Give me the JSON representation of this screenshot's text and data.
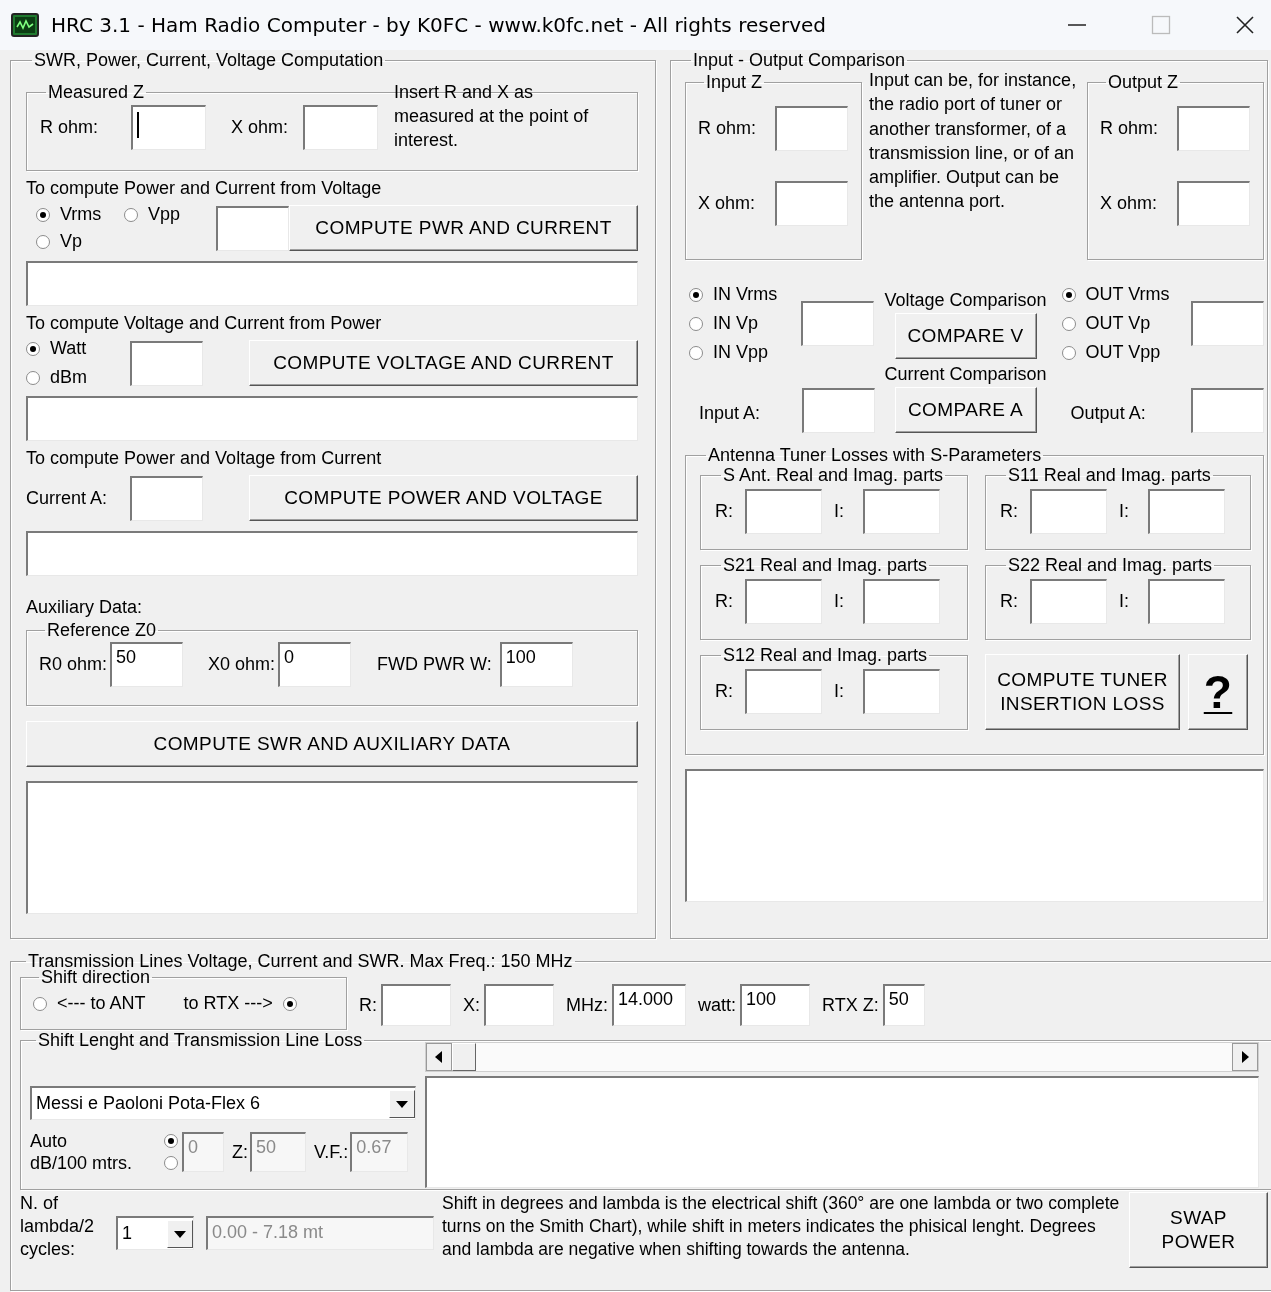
{
  "window": {
    "title": "HRC 3.1 - Ham Radio Computer - by K0FC - www.k0fc.net - All rights reserved"
  },
  "swr_panel": {
    "title": "SWR, Power, Current, Voltage Computation",
    "measured_z": {
      "title": "Measured Z",
      "fields": [
        {
          "label": "R ohm:",
          "focused": true
        },
        {
          "label": "X ohm:",
          "focused": false
        }
      ],
      "note": "Insert R and X as measured at the point of interest."
    },
    "from_voltage": {
      "heading": "To compute Power and Current from Voltage",
      "options": [
        {
          "label": "Vrms",
          "selected": true
        },
        {
          "label": "Vpp",
          "selected": false
        },
        {
          "label": "Vp",
          "selected": false
        }
      ],
      "button": "COMPUTE PWR AND CURRENT"
    },
    "from_power": {
      "heading": "To compute Voltage and Current from Power",
      "options": [
        {
          "label": "Watt",
          "selected": true
        },
        {
          "label": "dBm",
          "selected": false
        }
      ],
      "button": "COMPUTE VOLTAGE AND CURRENT"
    },
    "from_current": {
      "heading": "To compute Power and Voltage from Current",
      "field_label": "Current A:",
      "button": "COMPUTE POWER AND VOLTAGE"
    },
    "auxiliary_label": "Auxiliary Data:",
    "reference_z0": {
      "title": "Reference Z0",
      "fields": [
        {
          "label": "R0 ohm:",
          "value": "50"
        },
        {
          "label": "X0 ohm:",
          "value": "0"
        },
        {
          "label": "FWD PWR W:",
          "value": "100"
        }
      ]
    },
    "compute_button": "COMPUTE SWR AND AUXILIARY DATA"
  },
  "io_panel": {
    "title": "Input - Output Comparison",
    "input_z": {
      "title": "Input Z",
      "fields": [
        {
          "label": "R ohm:"
        },
        {
          "label": "X ohm:"
        }
      ]
    },
    "note": "Input can be, for instance, the radio port of tuner or another transformer, of a transmission line, or of an amplifier. Output can be the antenna port.",
    "output_z": {
      "title": "Output Z",
      "fields": [
        {
          "label": "R ohm:"
        },
        {
          "label": "X ohm:"
        }
      ]
    },
    "voltage_comparison": {
      "label": "Voltage Comparison",
      "in_options": [
        {
          "label": "IN Vrms",
          "selected": true
        },
        {
          "label": "IN Vp",
          "selected": false
        },
        {
          "label": "IN Vpp",
          "selected": false
        }
      ],
      "button": "COMPARE V",
      "out_options": [
        {
          "label": "OUT Vrms",
          "selected": true
        },
        {
          "label": "OUT Vp",
          "selected": false
        },
        {
          "label": "OUT Vpp",
          "selected": false
        }
      ]
    },
    "current_comparison": {
      "label": "Current Comparison",
      "input_label": "Input A:",
      "button": "COMPARE A",
      "output_label": "Output A:"
    },
    "tuner_losses": {
      "title": "Antenna Tuner Losses with S-Parameters",
      "groups": [
        {
          "title": "S Ant. Real and Imag. parts",
          "real_label": "R:",
          "imag_label": "I:"
        },
        {
          "title": "S11 Real and Imag. parts",
          "real_label": "R:",
          "imag_label": "I:"
        },
        {
          "title": "S21 Real and Imag. parts",
          "real_label": "R:",
          "imag_label": "I:"
        },
        {
          "title": "S22 Real and Imag. parts",
          "real_label": "R:",
          "imag_label": "I:"
        },
        {
          "title": "S12 Real and Imag. parts",
          "real_label": "R:",
          "imag_label": "I:"
        }
      ],
      "button": "COMPUTE TUNER INSERTION LOSS",
      "help_button": "?"
    }
  },
  "transmission_lines": {
    "title": "Transmission Lines Voltage, Current and SWR. Max Freq.: 150 MHz",
    "shift_direction": {
      "title": "Shift direction",
      "options": [
        {
          "label": "<--- to ANT",
          "selected": false
        },
        {
          "label": "to RTX --->",
          "selected": true
        }
      ]
    },
    "fields": [
      {
        "label": "R:"
      },
      {
        "label": "X:"
      },
      {
        "label": "MHz:",
        "value": "14.000"
      },
      {
        "label": "watt:",
        "value": "100"
      },
      {
        "label": "RTX Z:",
        "value": "50"
      }
    ],
    "shift_length": {
      "title": "Shift Lenght and Transmission Line Loss",
      "cable": "Messi e Paoloni Pota-Flex 6",
      "loss_options": [
        {
          "label": "Auto",
          "selected": true
        },
        {
          "label": "dB/100 mtrs.",
          "selected": false
        }
      ],
      "loss_value": {
        "value": "0",
        "disabled": true
      },
      "z": {
        "label": "Z:",
        "value": "50",
        "disabled": true
      },
      "vf": {
        "label": "V.F.:",
        "value": "0.67",
        "disabled": true
      }
    },
    "cycles": {
      "label": "N. of lambda/2 cycles:",
      "value": "1",
      "range": {
        "value": "0.00 - 7.18 mt",
        "disabled": true
      }
    },
    "note": "Shift in degrees and lambda is the electrical shift (360° are one lambda or two complete turns on the Smith Chart), while shift in meters indicates the phisical lenght. Degrees and lambda are negative when shifting towards the antenna.",
    "swap_button": "SWAP POWER"
  }
}
